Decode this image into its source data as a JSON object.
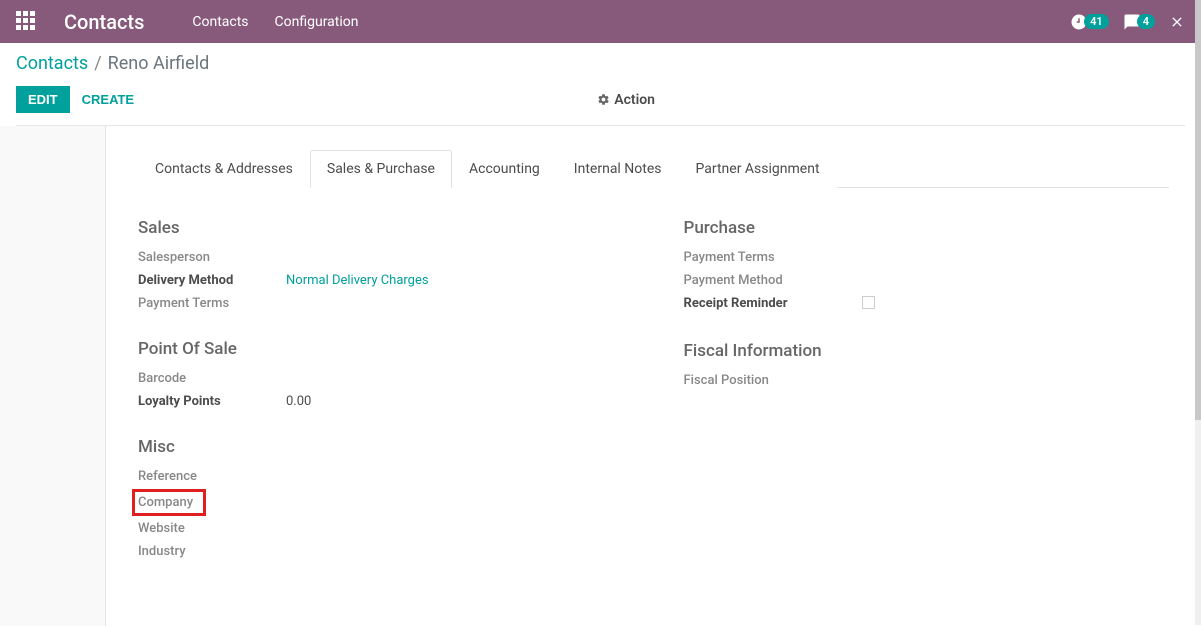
{
  "topbar": {
    "brand": "Contacts",
    "nav": [
      "Contacts",
      "Configuration"
    ],
    "badge1": "41",
    "badge2": "4"
  },
  "breadcrumb": {
    "root": "Contacts",
    "current": "Reno Airfield"
  },
  "buttons": {
    "edit": "EDIT",
    "create": "CREATE",
    "action": "Action"
  },
  "tabs": [
    "Contacts & Addresses",
    "Sales & Purchase",
    "Accounting",
    "Internal Notes",
    "Partner Assignment"
  ],
  "sections": {
    "sales": {
      "title": "Sales",
      "salesperson": "Salesperson",
      "delivery_method": "Delivery Method",
      "delivery_value": "Normal Delivery Charges",
      "payment_terms": "Payment Terms"
    },
    "pos": {
      "title": "Point Of Sale",
      "barcode": "Barcode",
      "loyalty": "Loyalty Points",
      "loyalty_value": "0.00"
    },
    "misc": {
      "title": "Misc",
      "reference": "Reference",
      "company": "Company",
      "website": "Website",
      "industry": "Industry"
    },
    "purchase": {
      "title": "Purchase",
      "payment_terms": "Payment Terms",
      "payment_method": "Payment Method",
      "receipt_reminder": "Receipt Reminder"
    },
    "fiscal": {
      "title": "Fiscal Information",
      "fiscal_position": "Fiscal Position"
    }
  }
}
